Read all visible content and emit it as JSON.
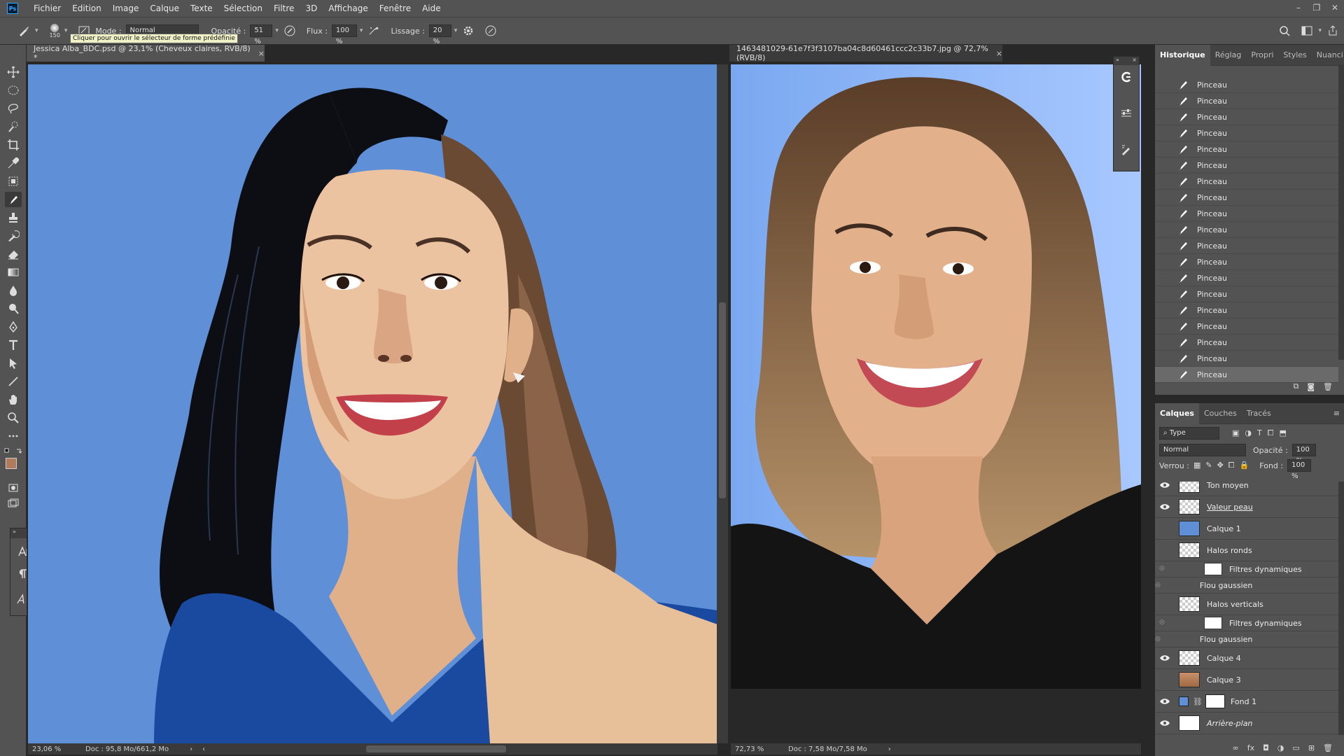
{
  "menu": [
    "Fichier",
    "Edition",
    "Image",
    "Calque",
    "Texte",
    "Sélection",
    "Filtre",
    "3D",
    "Affichage",
    "Fenêtre",
    "Aide"
  ],
  "options": {
    "brush_size": "150",
    "mode_label": "Mode :",
    "mode_value": "Normal",
    "opacity_label": "Opacité :",
    "opacity_value": "51 %",
    "flow_label": "Flux :",
    "flow_value": "100 %",
    "smoothing_label": "Lissage :",
    "smoothing_value": "20 %",
    "tooltip": "Cliquer pour ouvrir le sélecteur de forme prédéfinie"
  },
  "doc1": {
    "tab": "Jessica Alba_BDC.psd @ 23,1% (Cheveux claires, RVB/8) *",
    "zoom": "23,06 %",
    "doc_info": "Doc : 95,8 Mo/661,2 Mo"
  },
  "doc2": {
    "tab": "1463481029-61e7f3f3107ba04c8d60461ccc2c33b7.jpg @ 72,7% (RVB/8)",
    "zoom": "72,73 %",
    "doc_info": "Doc : 7,58 Mo/7,58 Mo"
  },
  "history_panel": {
    "tabs": [
      "Historique",
      "Réglag",
      "Propri",
      "Styles",
      "Nuanci"
    ],
    "items": [
      "Pinceau",
      "Pinceau",
      "Pinceau",
      "Pinceau",
      "Pinceau",
      "Pinceau",
      "Pinceau",
      "Pinceau",
      "Pinceau",
      "Pinceau",
      "Pinceau",
      "Pinceau",
      "Pinceau",
      "Pinceau",
      "Pinceau",
      "Pinceau",
      "Pinceau",
      "Pinceau",
      "Pinceau"
    ]
  },
  "layers_panel": {
    "tabs": [
      "Calques",
      "Couches",
      "Tracés"
    ],
    "filter_type": "Type",
    "blend_mode": "Normal",
    "opacity_label": "Opacité :",
    "opacity_value": "100 %",
    "lock_label": "Verrou :",
    "fill_label": "Fond :",
    "fill_value": "100 %",
    "layers": [
      {
        "name": "Ton moyen",
        "visible": true
      },
      {
        "name": "Valeur peau",
        "visible": true
      },
      {
        "name": "Calque 1",
        "visible": false
      },
      {
        "name": "Halos ronds",
        "visible": false
      },
      {
        "name": "Filtres dynamiques",
        "visible": false
      },
      {
        "name": "Flou gaussien",
        "visible": false
      },
      {
        "name": "Halos verticals",
        "visible": false
      },
      {
        "name": "Filtres dynamiques",
        "visible": false
      },
      {
        "name": "Flou gaussien",
        "visible": false
      },
      {
        "name": "Calque 4",
        "visible": true
      },
      {
        "name": "Calque 3",
        "visible": false
      },
      {
        "name": "Fond 1",
        "visible": true
      },
      {
        "name": "Arrière-plan",
        "visible": true
      }
    ]
  },
  "colors": {
    "canvas_bg": "#5f8fd6",
    "dress": "#1a4aa0",
    "foreground_swatch": "#b07a5c",
    "background_swatch": "#000000"
  }
}
